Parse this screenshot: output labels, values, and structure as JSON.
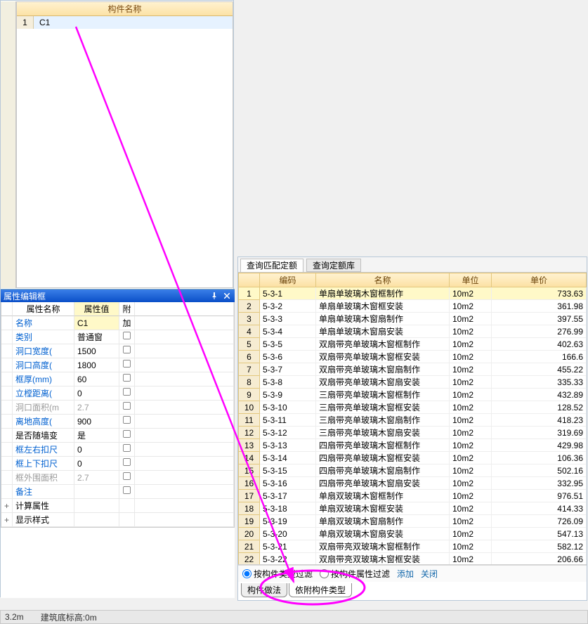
{
  "leftGrid": {
    "header": "构件名称",
    "rows": [
      {
        "n": "1",
        "name": "C1"
      }
    ]
  },
  "propPanel": {
    "title": "属性编辑框",
    "headers": {
      "name": "属性名称",
      "value": "属性值",
      "extra": "附加"
    },
    "rows": [
      {
        "label": "名称",
        "value": "C1",
        "blue": true,
        "hl": true
      },
      {
        "label": "类别",
        "value": "普通窗",
        "blue": true,
        "chk": true
      },
      {
        "label": "洞口宽度(",
        "value": "1500",
        "blue": true,
        "chk": true
      },
      {
        "label": "洞口高度(",
        "value": "1800",
        "blue": true,
        "chk": true
      },
      {
        "label": "框厚(mm)",
        "value": "60",
        "blue": true,
        "chk": true
      },
      {
        "label": "立樘距离(",
        "value": "0",
        "blue": true,
        "chk": true
      },
      {
        "label": "洞口面积(m",
        "value": "2.7",
        "gray": true,
        "chk": true
      },
      {
        "label": "离地高度(",
        "value": "900",
        "blue": true,
        "chk": true
      },
      {
        "label": "是否随墙变",
        "value": "是",
        "chk": true
      },
      {
        "label": "框左右扣尺",
        "value": "0",
        "blue": true,
        "chk": true
      },
      {
        "label": "框上下扣尺",
        "value": "0",
        "blue": true,
        "chk": true
      },
      {
        "label": "框外围面积",
        "value": "2.7",
        "gray": true,
        "chk": true
      },
      {
        "label": "备注",
        "value": "",
        "blue": true,
        "chk": true
      }
    ],
    "groups": [
      {
        "t": "+",
        "label": "计算属性"
      },
      {
        "t": "+",
        "label": "显示样式"
      }
    ]
  },
  "rightTabs": {
    "active": "查询匹配定额",
    "inactive": "查询定额库"
  },
  "rgrid": {
    "headers": {
      "code": "编码",
      "name": "名称",
      "unit": "单位",
      "price": "单价"
    },
    "rows": [
      {
        "n": "1",
        "code": "5-3-1",
        "name": "单扇单玻璃木窗框制作",
        "unit": "10m2",
        "price": "733.63",
        "sel": true
      },
      {
        "n": "2",
        "code": "5-3-2",
        "name": "单扇单玻璃木窗框安装",
        "unit": "10m2",
        "price": "361.98"
      },
      {
        "n": "3",
        "code": "5-3-3",
        "name": "单扇单玻璃木窗扇制作",
        "unit": "10m2",
        "price": "397.55"
      },
      {
        "n": "4",
        "code": "5-3-4",
        "name": "单扇单玻璃木窗扇安装",
        "unit": "10m2",
        "price": "276.99"
      },
      {
        "n": "5",
        "code": "5-3-5",
        "name": "双扇带亮单玻璃木窗框制作",
        "unit": "10m2",
        "price": "402.63"
      },
      {
        "n": "6",
        "code": "5-3-6",
        "name": "双扇带亮单玻璃木窗框安装",
        "unit": "10m2",
        "price": "166.6"
      },
      {
        "n": "7",
        "code": "5-3-7",
        "name": "双扇带亮单玻璃木窗扇制作",
        "unit": "10m2",
        "price": "455.22"
      },
      {
        "n": "8",
        "code": "5-3-8",
        "name": "双扇带亮单玻璃木窗扇安装",
        "unit": "10m2",
        "price": "335.33"
      },
      {
        "n": "9",
        "code": "5-3-9",
        "name": "三扇带亮单玻璃木窗框制作",
        "unit": "10m2",
        "price": "432.89"
      },
      {
        "n": "10",
        "code": "5-3-10",
        "name": "三扇带亮单玻璃木窗框安装",
        "unit": "10m2",
        "price": "128.52"
      },
      {
        "n": "11",
        "code": "5-3-11",
        "name": "三扇带亮单玻璃木窗扇制作",
        "unit": "10m2",
        "price": "418.23"
      },
      {
        "n": "12",
        "code": "5-3-12",
        "name": "三扇带亮单玻璃木窗扇安装",
        "unit": "10m2",
        "price": "319.69"
      },
      {
        "n": "13",
        "code": "5-3-13",
        "name": "四扇带亮单玻璃木窗框制作",
        "unit": "10m2",
        "price": "429.98"
      },
      {
        "n": "14",
        "code": "5-3-14",
        "name": "四扇带亮单玻璃木窗框安装",
        "unit": "10m2",
        "price": "106.36"
      },
      {
        "n": "15",
        "code": "5-3-15",
        "name": "四扇带亮单玻璃木窗扇制作",
        "unit": "10m2",
        "price": "502.16"
      },
      {
        "n": "16",
        "code": "5-3-16",
        "name": "四扇带亮单玻璃木窗扇安装",
        "unit": "10m2",
        "price": "332.95"
      },
      {
        "n": "17",
        "code": "5-3-17",
        "name": "单扇双玻璃木窗框制作",
        "unit": "10m2",
        "price": "976.51"
      },
      {
        "n": "18",
        "code": "5-3-18",
        "name": "单扇双玻璃木窗框安装",
        "unit": "10m2",
        "price": "414.33"
      },
      {
        "n": "19",
        "code": "5-3-19",
        "name": "单扇双玻璃木窗扇制作",
        "unit": "10m2",
        "price": "726.09"
      },
      {
        "n": "20",
        "code": "5-3-20",
        "name": "单扇双玻璃木窗扇安装",
        "unit": "10m2",
        "price": "547.13"
      },
      {
        "n": "21",
        "code": "5-3-21",
        "name": "双扇带亮双玻璃木窗框制作",
        "unit": "10m2",
        "price": "582.12"
      },
      {
        "n": "22",
        "code": "5-3-22",
        "name": "双扇带亮双玻璃木窗框安装",
        "unit": "10m2",
        "price": "206.66"
      }
    ]
  },
  "filter": {
    "byType": "按构件类型过滤",
    "byProp": "按构件属性过滤",
    "add": "添加",
    "close": "关闭"
  },
  "btabs": {
    "a": "构件做法",
    "b": "依附构件类型"
  },
  "status": {
    "left": "3.2m",
    "right": "建筑底标高:0m"
  }
}
